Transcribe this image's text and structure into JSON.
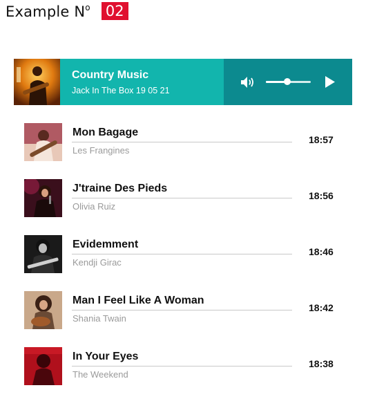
{
  "heading": {
    "label": "Example N",
    "superscript": "o",
    "badge": "02"
  },
  "player": {
    "title": "Country Music",
    "subtitle": "Jack In The Box 19 05 21",
    "volume_icon": "speaker-volume-icon",
    "play_icon": "play-icon",
    "volume_level": 0.48,
    "colors": {
      "info_bg": "#12b5ad",
      "controls_bg": "#0c8a8f"
    }
  },
  "tracks": [
    {
      "title": "Mon Bagage",
      "artist": "Les Frangines",
      "time": "18:57"
    },
    {
      "title": "J'traine Des Pieds",
      "artist": "Olivia Ruiz",
      "time": "18:56"
    },
    {
      "title": "Evidemment",
      "artist": "Kendji Girac",
      "time": "18:46"
    },
    {
      "title": "Man I Feel Like A Woman",
      "artist": "Shania Twain",
      "time": "18:42"
    },
    {
      "title": "In Your Eyes",
      "artist": "The Weekend",
      "time": "18:38"
    }
  ],
  "colors": {
    "accent_red": "#e0102f",
    "divider": "#c8c8c8",
    "artist_gray": "#9a9a9a"
  }
}
